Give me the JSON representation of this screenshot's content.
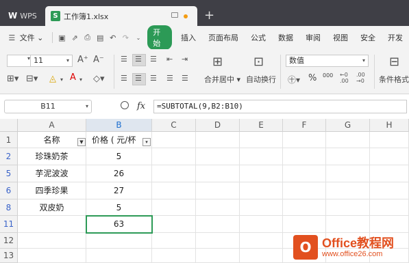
{
  "titlebar": {
    "app_label": "WPS",
    "doc_tab": "工作簿1.xlsx",
    "new_tab": "+"
  },
  "menu": {
    "file": "文件",
    "start": "开始",
    "items": [
      "插入",
      "页面布局",
      "公式",
      "数据",
      "审阅",
      "视图",
      "安全",
      "开发"
    ]
  },
  "ribbon": {
    "font_size": "11",
    "merge_center": "合并居中",
    "wrap_text": "自动换行",
    "number_format": "数值",
    "conditional_format": "条件格式",
    "percent": "%",
    "thousands": "000"
  },
  "formula_bar": {
    "cell_ref": "B11",
    "fx": "fx",
    "formula": "=SUBTOTAL(9,B2:B10)"
  },
  "sheet": {
    "columns": [
      "A",
      "B",
      "C",
      "D",
      "E",
      "F",
      "G",
      "H"
    ],
    "rows": [
      {
        "num": "1",
        "a": "名称",
        "b": "价格 ( 元/杯"
      },
      {
        "num": "2",
        "a": "珍珠奶茶",
        "b": "5"
      },
      {
        "num": "5",
        "a": "芋泥波波",
        "b": "26"
      },
      {
        "num": "6",
        "a": "四季珍果",
        "b": "27"
      },
      {
        "num": "8",
        "a": "双皮奶",
        "b": "5"
      },
      {
        "num": "11",
        "a": "",
        "b": "63"
      },
      {
        "num": "12",
        "a": "",
        "b": ""
      },
      {
        "num": "13",
        "a": "",
        "b": ""
      }
    ]
  },
  "watermark": {
    "title": "Office教程网",
    "url": "www.office26.com"
  },
  "colors": {
    "titlebar": "#3f3f46",
    "accent_green": "#2c9a56",
    "watermark_orange": "#e2501f"
  }
}
